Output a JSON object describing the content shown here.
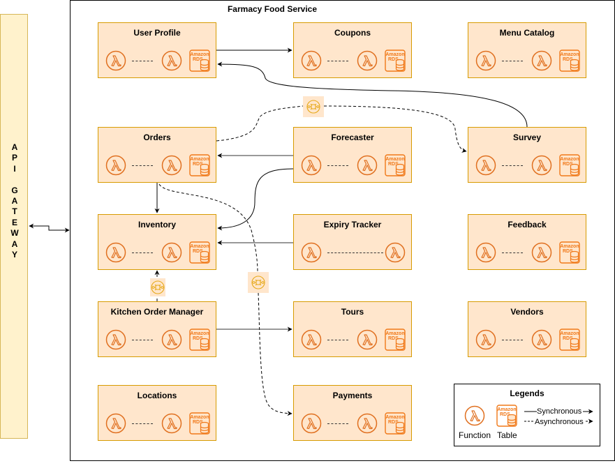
{
  "api_gateway": {
    "label": "API GATEWAY",
    "letters": [
      "A",
      "P",
      "I",
      "",
      "G",
      "A",
      "T",
      "E",
      "W",
      "A",
      "Y"
    ]
  },
  "frame": {
    "title": "Farmacy Food Service"
  },
  "services": [
    {
      "id": "user-profile",
      "title": "User Profile",
      "components": [
        "function",
        "function",
        "table"
      ]
    },
    {
      "id": "coupons",
      "title": "Coupons",
      "components": [
        "function",
        "function",
        "table"
      ]
    },
    {
      "id": "menu-catalog",
      "title": "Menu Catalog",
      "components": [
        "function",
        "function",
        "table"
      ]
    },
    {
      "id": "orders",
      "title": "Orders",
      "components": [
        "function",
        "function",
        "table"
      ]
    },
    {
      "id": "forecaster",
      "title": "Forecaster",
      "components": [
        "function",
        "function",
        "table"
      ]
    },
    {
      "id": "survey",
      "title": "Survey",
      "components": [
        "function",
        "function",
        "table"
      ]
    },
    {
      "id": "inventory",
      "title": "Inventory",
      "components": [
        "function",
        "function",
        "table"
      ]
    },
    {
      "id": "expiry-tracker",
      "title": "Expiry Tracker",
      "components": [
        "function",
        "function"
      ]
    },
    {
      "id": "feedback",
      "title": "Feedback",
      "components": [
        "function",
        "function",
        "table"
      ]
    },
    {
      "id": "kitchen-order-manager",
      "title": "Kitchen Order Manager",
      "components": [
        "function",
        "function",
        "table"
      ]
    },
    {
      "id": "tours",
      "title": "Tours",
      "components": [
        "function",
        "function",
        "table"
      ]
    },
    {
      "id": "vendors",
      "title": "Vendors",
      "components": [
        "function",
        "function",
        "table"
      ]
    },
    {
      "id": "locations",
      "title": "Locations",
      "components": [
        "function",
        "function",
        "table"
      ]
    },
    {
      "id": "payments",
      "title": "Payments",
      "components": [
        "function",
        "function",
        "table"
      ]
    }
  ],
  "rds_label": {
    "line1": "Amazon",
    "line2": "RDS"
  },
  "connections": [
    {
      "from": "api-gateway",
      "to": "farmacy-food-service",
      "type": "synchronous",
      "bidirectional": true
    },
    {
      "from": "user-profile",
      "to": "coupons",
      "type": "synchronous"
    },
    {
      "from": "survey",
      "to": "user-profile",
      "type": "synchronous"
    },
    {
      "from": "orders",
      "to": "survey",
      "type": "asynchronous",
      "via": "queue"
    },
    {
      "from": "forecaster",
      "to": "orders",
      "type": "synchronous"
    },
    {
      "from": "forecaster",
      "to": "inventory",
      "type": "synchronous"
    },
    {
      "from": "orders",
      "to": "inventory",
      "type": "synchronous"
    },
    {
      "from": "expiry-tracker",
      "to": "inventory",
      "type": "synchronous"
    },
    {
      "from": "kitchen-order-manager",
      "to": "inventory",
      "type": "asynchronous",
      "via": "queue"
    },
    {
      "from": "orders",
      "to": "payments",
      "type": "asynchronous",
      "via": "queue"
    },
    {
      "from": "kitchen-order-manager",
      "to": "tours",
      "type": "synchronous"
    }
  ],
  "legend": {
    "title": "Legends",
    "function_label": "Function",
    "table_label": "Table",
    "sync_label": "Synchronous",
    "async_label": "Asynchronous"
  },
  "colors": {
    "service_fill": "#ffe6cc",
    "service_border": "#d79b00",
    "icon_orange": "#e07020",
    "gateway_fill": "#fff2cc",
    "gateway_border": "#d6b656",
    "queue_icon": "#e6a817"
  }
}
